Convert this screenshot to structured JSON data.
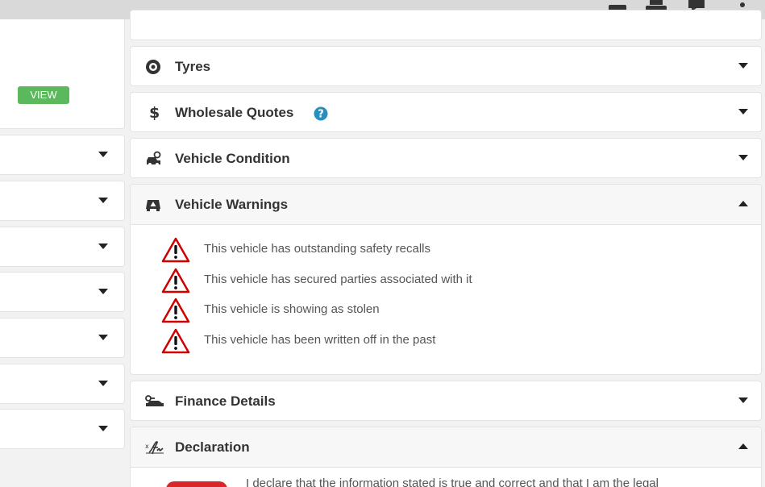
{
  "toolbar": {
    "icons": [
      "camera-icon",
      "print-icon",
      "chat-icon",
      "more-vertical-icon"
    ]
  },
  "left": {
    "view_label": "VIEW",
    "rows": 7
  },
  "panels": {
    "tyres": {
      "title": "Tyres",
      "icon": "tyre-icon"
    },
    "wholesale": {
      "title": "Wholesale Quotes",
      "icon": "dollar-icon",
      "help_icon": "question-circle-icon"
    },
    "condition": {
      "title": "Vehicle Condition",
      "icon": "car-search-icon"
    },
    "warnings": {
      "title": "Vehicle Warnings",
      "icon": "car-warning-icon",
      "items": [
        "This vehicle has outstanding safety recalls",
        "This vehicle has secured parties associated with it",
        "This vehicle is showing as stolen",
        "This vehicle has been written off in the past"
      ]
    },
    "finance": {
      "title": "Finance Details",
      "icon": "car-key-icon"
    },
    "declaration": {
      "title": "Declaration",
      "icon": "signature-icon",
      "text": "I declare that the information stated is true and correct and that I am the legal"
    }
  },
  "colors": {
    "green": "#5cb85c",
    "help": "#2a8fbd",
    "warning_red": "#d00000",
    "accent_red": "#d9262b"
  }
}
